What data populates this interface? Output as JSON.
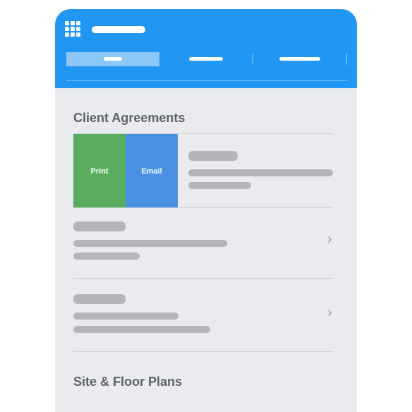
{
  "header": {
    "menu_icon": "grid-menu-icon",
    "tabs": [
      "",
      "",
      ""
    ]
  },
  "sections": [
    {
      "title": "Client Agreements"
    },
    {
      "title": "Site & Floor Plans"
    }
  ],
  "swipe_actions": {
    "print_label": "Print",
    "email_label": "Email"
  },
  "icons": {
    "chevron": "chevron-right-icon"
  },
  "colors": {
    "header": "#2196f3",
    "active_tab": "#8ec8f8",
    "print": "#5aad5e",
    "email": "#4a90e2",
    "background": "#e9ebef",
    "placeholder": "#b3b5b9",
    "title_text": "#5f6368"
  }
}
